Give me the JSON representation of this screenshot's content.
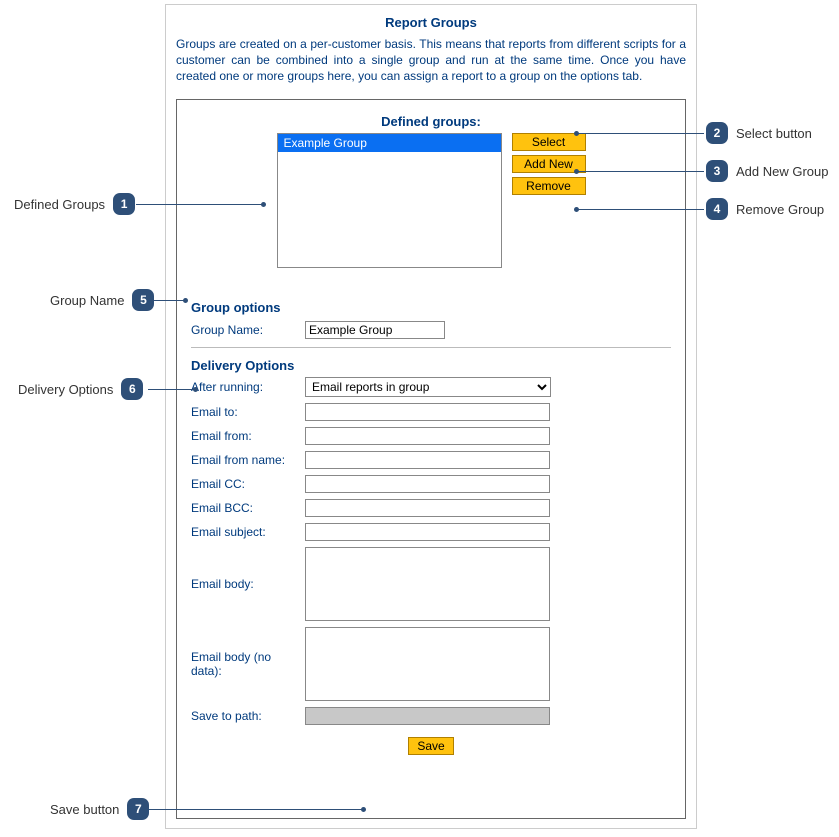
{
  "title": "Report Groups",
  "intro": "Groups are created on a per-customer basis. This means that reports from different scripts for a customer can be combined into a single group and run at the same time. Once you have created one or more groups here, you can assign a report to a group on the options tab.",
  "defined_groups": {
    "label": "Defined groups:",
    "items": [
      "Example Group"
    ],
    "buttons": {
      "select": "Select",
      "add": "Add New",
      "remove": "Remove"
    }
  },
  "group_options": {
    "title": "Group options",
    "group_name_label": "Group Name:",
    "group_name_value": "Example Group"
  },
  "delivery": {
    "title": "Delivery Options",
    "after_running_label": "After running:",
    "after_running_value": "Email reports in group",
    "email_to_label": "Email to:",
    "email_from_label": "Email from:",
    "email_from_name_label": "Email from name:",
    "email_cc_label": "Email CC:",
    "email_bcc_label": "Email BCC:",
    "email_subject_label": "Email subject:",
    "email_body_label": "Email body:",
    "email_body_nodata_label": "Email body (no data):",
    "save_to_path_label": "Save to path:"
  },
  "save_button": "Save",
  "callouts": {
    "c1": {
      "num": "1",
      "text": "Defined Groups"
    },
    "c2": {
      "num": "2",
      "text": "Select button"
    },
    "c3": {
      "num": "3",
      "text": "Add New Group"
    },
    "c4": {
      "num": "4",
      "text": "Remove Group"
    },
    "c5": {
      "num": "5",
      "text": "Group Name"
    },
    "c6": {
      "num": "6",
      "text": "Delivery Options"
    },
    "c7": {
      "num": "7",
      "text": "Save button"
    }
  }
}
